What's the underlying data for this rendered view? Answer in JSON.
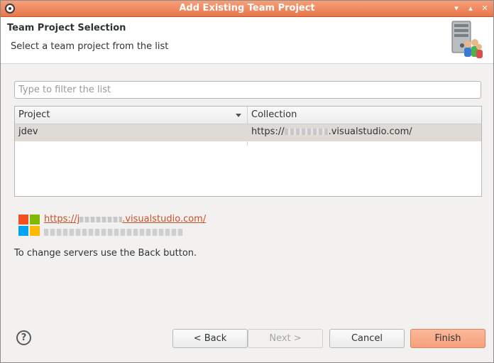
{
  "window": {
    "title": "Add Existing Team Project",
    "controls": {
      "minimize": "▾",
      "maximize": "▴",
      "close": "✕"
    }
  },
  "banner": {
    "heading": "Team Project Selection",
    "subheading": "Select a team project from the list",
    "illustration_icon": "server-users-icon"
  },
  "filter": {
    "placeholder": "Type to filter the list",
    "value": ""
  },
  "table": {
    "columns": [
      "Project",
      "Collection"
    ],
    "rows": [
      {
        "project": "jdev",
        "collection_prefix": "https://",
        "collection_suffix": ".visualstudio.com/"
      }
    ]
  },
  "account": {
    "logo_icon": "microsoft-logo",
    "link_prefix": "https://j",
    "link_suffix": ".visualstudio.com/"
  },
  "hint": "To change servers use the Back button.",
  "buttons": {
    "help": "?",
    "back": "< Back",
    "next": "Next >",
    "cancel": "Cancel",
    "finish": "Finish"
  },
  "colors": {
    "titlebar": "#e9754a",
    "link": "#c8502a",
    "finish_button": "#f6a07c",
    "selected_row": "#dedad6"
  }
}
